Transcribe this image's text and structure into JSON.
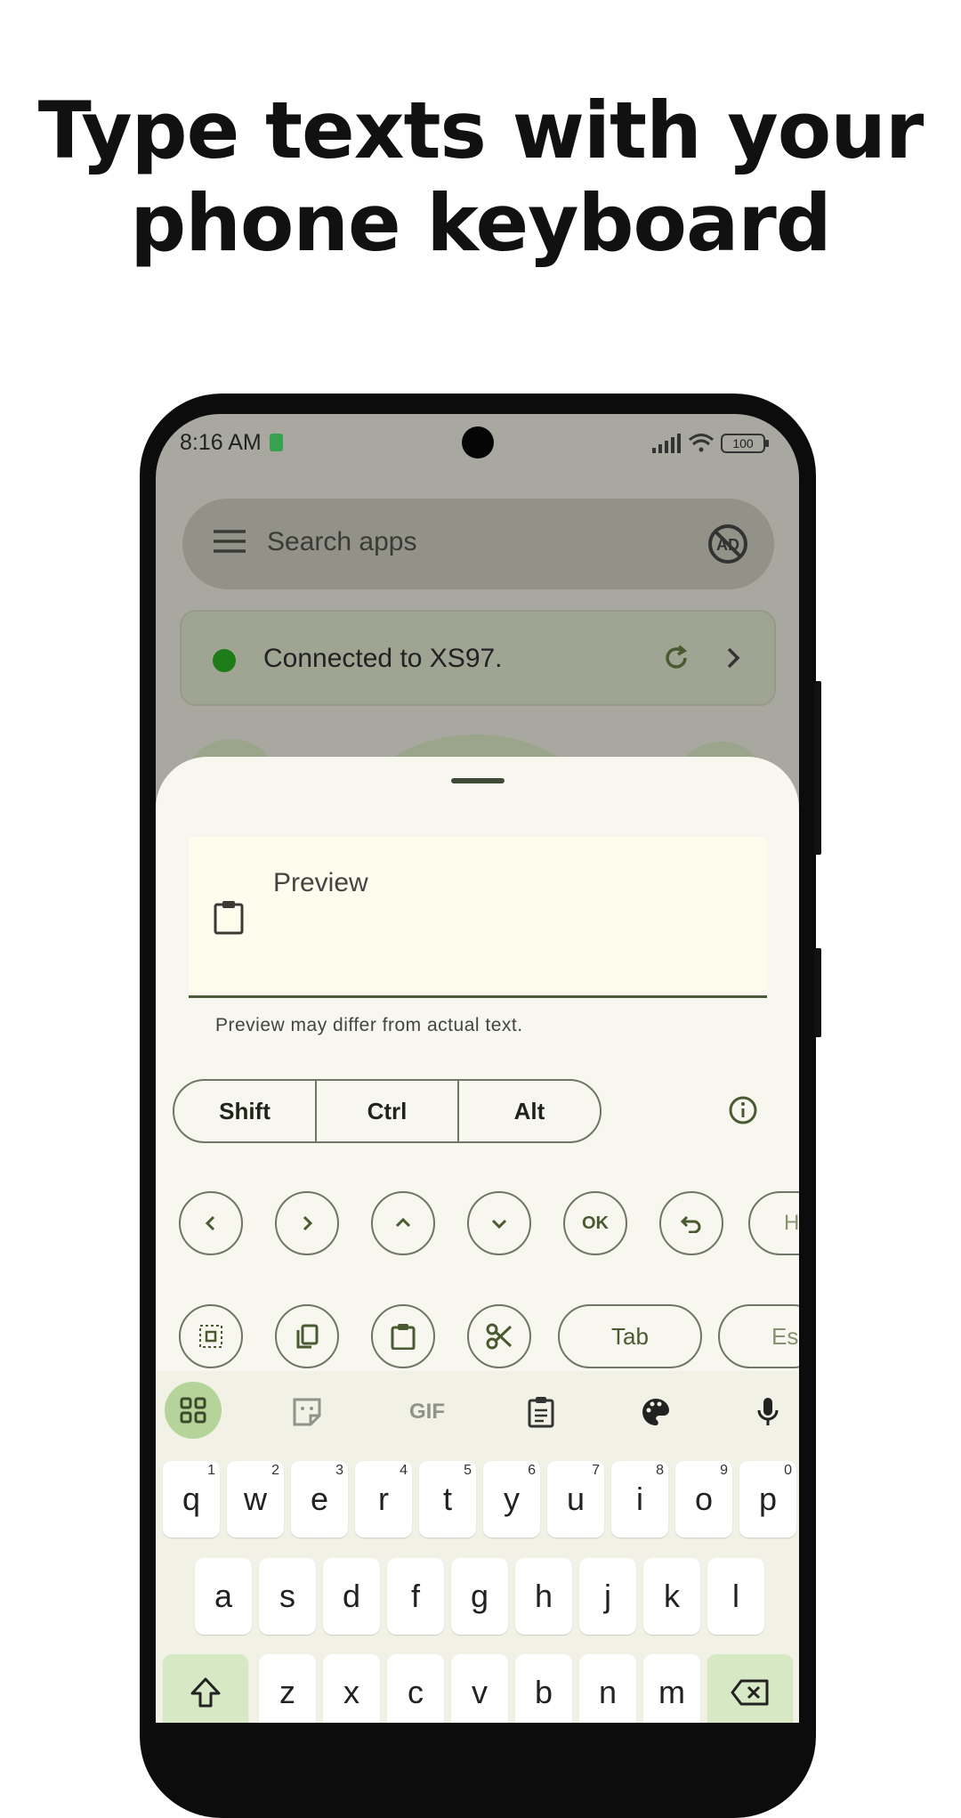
{
  "headline": {
    "line1": "Type texts with your",
    "line2": "phone keyboard"
  },
  "status_bar": {
    "time": "8:16 AM",
    "battery": "100"
  },
  "search": {
    "placeholder": "Search apps"
  },
  "connection": {
    "text": "Connected to XS97."
  },
  "preview": {
    "label": "Preview",
    "helper": "Preview may differ from actual text."
  },
  "modifiers": [
    "Shift",
    "Ctrl",
    "Alt"
  ],
  "nav_keys": {
    "ok": "OK",
    "partial_label": "H"
  },
  "edit_keys": {
    "tab": "Tab",
    "esc_partial": "Es"
  },
  "keyboard": {
    "toolbar": {
      "gif": "GIF"
    },
    "row1": [
      {
        "k": "q",
        "h": "1"
      },
      {
        "k": "w",
        "h": "2"
      },
      {
        "k": "e",
        "h": "3"
      },
      {
        "k": "r",
        "h": "4"
      },
      {
        "k": "t",
        "h": "5"
      },
      {
        "k": "y",
        "h": "6"
      },
      {
        "k": "u",
        "h": "7"
      },
      {
        "k": "i",
        "h": "8"
      },
      {
        "k": "o",
        "h": "9"
      },
      {
        "k": "p",
        "h": "0"
      }
    ],
    "row2": [
      "a",
      "s",
      "d",
      "f",
      "g",
      "h",
      "j",
      "k",
      "l"
    ],
    "row3": [
      "z",
      "x",
      "c",
      "v",
      "b",
      "n",
      "m"
    ]
  },
  "colors": {
    "accent": "#4a5a30",
    "connected_dot": "#1d7c17",
    "apps_highlight": "#b6d39a"
  }
}
